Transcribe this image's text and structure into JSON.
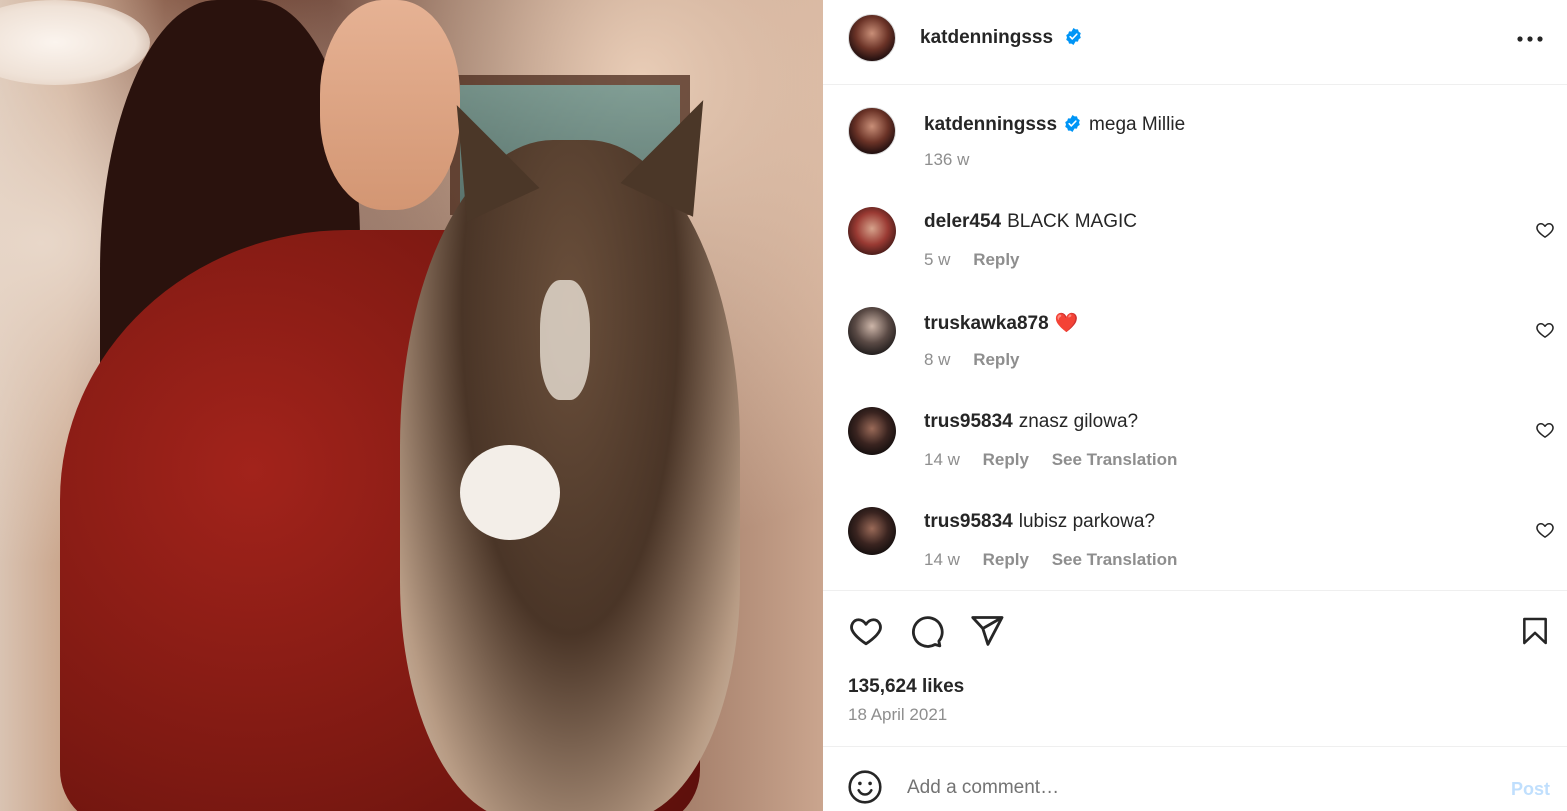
{
  "colors": {
    "verified": "#0095f6",
    "heart_red": "#ed4956",
    "muted": "#8e8e8e",
    "post_disabled": "#c0dffd"
  },
  "post": {
    "author": "katdenningsss",
    "caption": "mega Millie",
    "caption_age": "136 w"
  },
  "comments": [
    {
      "user": "deler454",
      "text": "BLACK MAGIC",
      "age": "5 w",
      "reply": "Reply",
      "translate": ""
    },
    {
      "user": "truskawka878",
      "text": "❤️",
      "age": "8 w",
      "reply": "Reply",
      "translate": ""
    },
    {
      "user": "trus95834",
      "text": "znasz gilowa?",
      "age": "14 w",
      "reply": "Reply",
      "translate": "See Translation"
    },
    {
      "user": "trus95834",
      "text": "lubisz parkowa?",
      "age": "14 w",
      "reply": "Reply",
      "translate": "See Translation"
    }
  ],
  "likes": "135,624 likes",
  "date": "18 April 2021",
  "composer": {
    "placeholder": "Add a comment…",
    "post_label": "Post"
  },
  "icons": {
    "more": "more-options-icon",
    "like": "heart-icon",
    "comment": "comment-icon",
    "share": "send-icon",
    "save": "bookmark-icon",
    "emoji": "emoji-icon",
    "verified": "verified-badge-icon"
  }
}
